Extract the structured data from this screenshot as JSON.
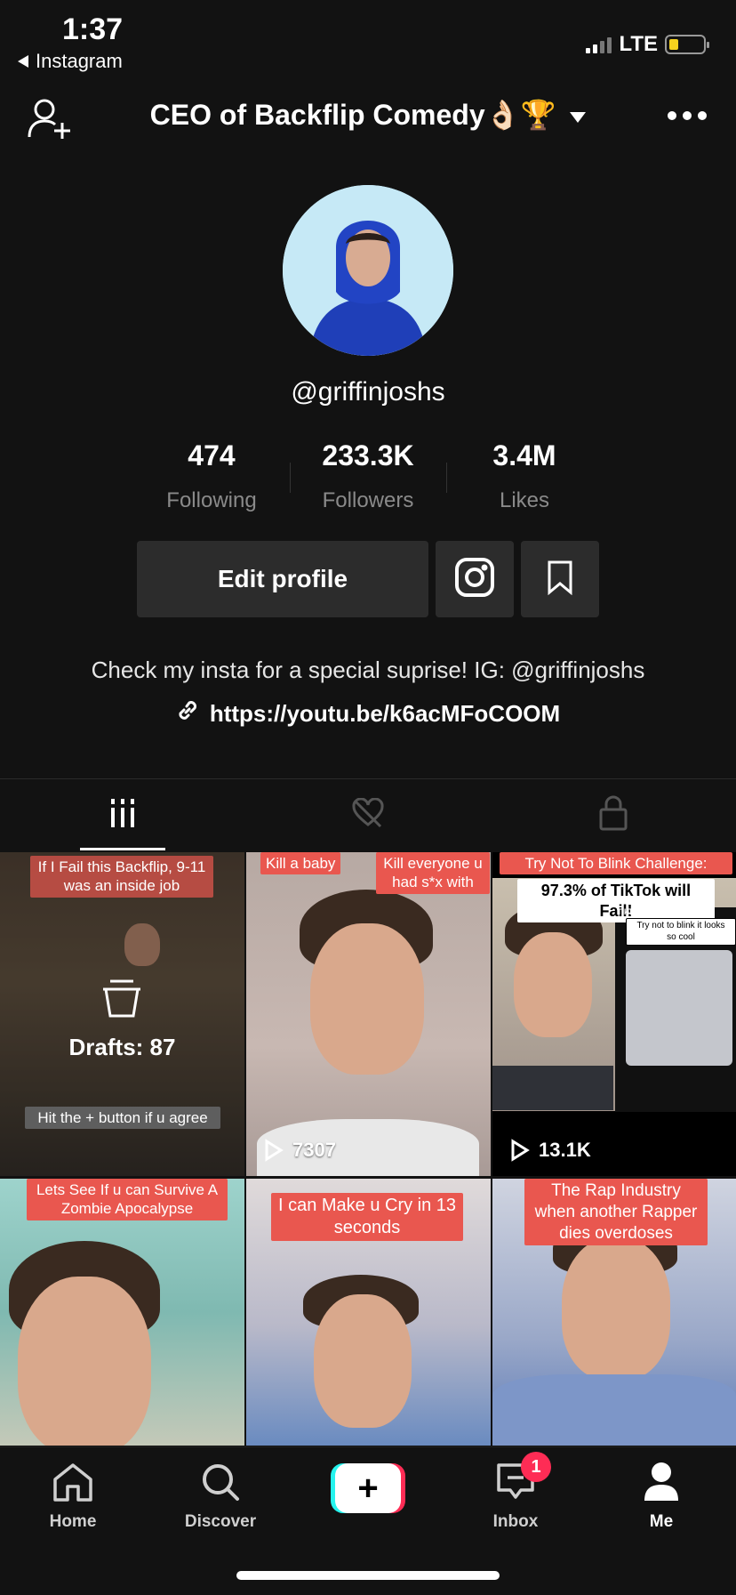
{
  "status_bar": {
    "time": "1:37",
    "back_app": "Instagram",
    "network": "LTE"
  },
  "header": {
    "title": "CEO of Backflip Comedy👌🏻🏆"
  },
  "profile": {
    "username": "@griffinjoshs",
    "stats": [
      {
        "value": "474",
        "label": "Following"
      },
      {
        "value": "233.3K",
        "label": "Followers"
      },
      {
        "value": "3.4M",
        "label": "Likes"
      }
    ],
    "edit_label": "Edit profile",
    "bio": "Check my insta for a special suprise! IG: @griffinjoshs",
    "link": "https://youtu.be/k6acMFoCOOM"
  },
  "tabs": [
    "videos-grid-icon",
    "liked-hidden-icon",
    "private-lock-icon"
  ],
  "videos": [
    {
      "captions": [
        "If I Fail this Backflip, 9-11 was an inside job",
        "Hit the + button if u agree"
      ],
      "drafts_label": "Drafts: 87"
    },
    {
      "captions": [
        "Kill a baby",
        "Kill everyone u had s*x with"
      ],
      "views": "7307"
    },
    {
      "captions": [
        "Try Not To Blink Challenge:",
        "97.3% of TikTok will Fail!",
        "TikTok",
        "Try not to blink it looks so cool"
      ],
      "views": "13.1K"
    },
    {
      "captions": [
        "Lets See If u can Survive A Zombie Apocalypse"
      ]
    },
    {
      "captions": [
        "I can Make u Cry in 13 seconds"
      ]
    },
    {
      "captions": [
        "The Rap Industry when another Rapper dies overdoses"
      ]
    }
  ],
  "nav": {
    "items": [
      {
        "label": "Home",
        "icon": "home-icon"
      },
      {
        "label": "Discover",
        "icon": "search-icon"
      },
      {
        "label": "Inbox",
        "icon": "inbox-icon"
      },
      {
        "label": "Me",
        "icon": "profile-icon"
      }
    ],
    "inbox_badge": "1"
  },
  "colors": {
    "background": "#121212",
    "button": "#2c2c2c",
    "accent": "#fe2c55",
    "cyan": "#25f4ee"
  }
}
